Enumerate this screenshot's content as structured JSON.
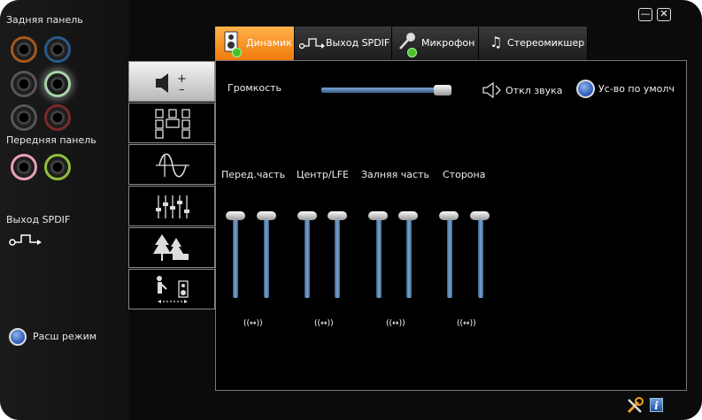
{
  "window": {
    "minimize_icon": "minimize-icon",
    "close_icon": "close-icon"
  },
  "left": {
    "rear_panel_label": "Задняя панель",
    "front_panel_label": "Передняя панель",
    "spdif_label": "Выход SPDIF",
    "advanced_mode_label": "Расш режим"
  },
  "tabs": [
    {
      "label": "Динамик",
      "active": true
    },
    {
      "label": "Выход SPDIF",
      "active": false
    },
    {
      "label": "Микрофон",
      "active": false
    },
    {
      "label": "Стереомикшер",
      "active": false
    }
  ],
  "main": {
    "volume_label": "Громкость",
    "volume_level": 0.92,
    "mute_label": "Откл звука",
    "default_device_label": "Ус-во по умолч"
  },
  "channels": [
    {
      "label": "Перед.часть",
      "left_level": 1.0,
      "right_level": 1.0
    },
    {
      "label": "Центр/LFE",
      "left_level": 1.0,
      "right_level": 1.0
    },
    {
      "label": "Залняя часть",
      "left_level": 1.0,
      "right_level": 1.0
    },
    {
      "label": "Сторона",
      "left_level": 1.0,
      "right_level": 1.0
    }
  ],
  "link_glyph": "((↔))",
  "colors": {
    "active_tab": "#f28a1a",
    "slider_blue": "#5a86b8",
    "radio_blue": "#2a5ab8"
  },
  "bottom_icons": [
    "settings-tools-icon",
    "info-icon"
  ]
}
